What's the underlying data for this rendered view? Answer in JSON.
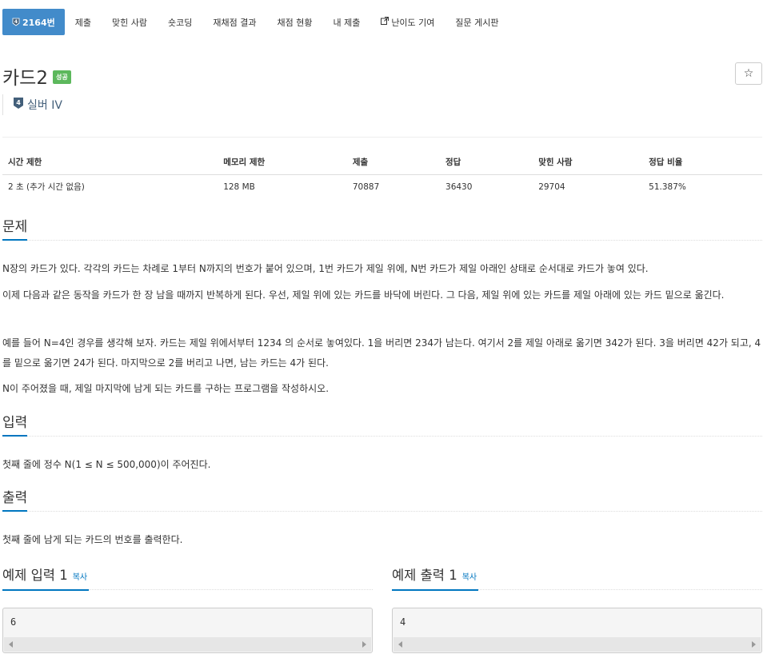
{
  "nav": {
    "tabs": [
      {
        "label": "2164번",
        "icon": "tier-badge-icon"
      },
      {
        "label": "제출"
      },
      {
        "label": "맞힌 사람"
      },
      {
        "label": "숏코딩"
      },
      {
        "label": "재채점 결과"
      },
      {
        "label": "채점 현황"
      },
      {
        "label": "내 제출"
      },
      {
        "label": "난이도 기여",
        "icon": "external-link-icon"
      },
      {
        "label": "질문 게시판"
      }
    ]
  },
  "problem": {
    "title": "카드2",
    "status_badge": "성공",
    "star": "☆",
    "tier_number": "4",
    "tier": "실버 IV"
  },
  "info_table": {
    "headers": [
      "시간 제한",
      "메모리 제한",
      "제출",
      "정답",
      "맞힌 사람",
      "정답 비율"
    ],
    "row": [
      "2 초 (추가 시간 없음)",
      "128 MB",
      "70887",
      "36430",
      "29704",
      "51.387%"
    ]
  },
  "sections": {
    "description_title": "문제",
    "description": [
      "N장의 카드가 있다. 각각의 카드는 차례로 1부터 N까지의 번호가 붙어 있으며, 1번 카드가 제일 위에, N번 카드가 제일 아래인 상태로 순서대로 카드가 놓여 있다.",
      "이제 다음과 같은 동작을 카드가 한 장 남을 때까지 반복하게 된다. 우선, 제일 위에 있는 카드를 바닥에 버린다. 그 다음, 제일 위에 있는 카드를 제일 아래에 있는 카드 밑으로 옮긴다.",
      "예를 들어 N=4인 경우를 생각해 보자. 카드는 제일 위에서부터 1234 의 순서로 놓여있다. 1을 버리면 234가 남는다. 여기서 2를 제일 아래로 옮기면 342가 된다. 3을 버리면 42가 되고, 4를 밑으로 옮기면 24가 된다. 마지막으로 2를 버리고 나면, 남는 카드는 4가 된다.",
      "N이 주어졌을 때, 제일 마지막에 남게 되는 카드를 구하는 프로그램을 작성하시오."
    ],
    "input_title": "입력",
    "input": "첫째 줄에 정수 N(1 ≤ N ≤ 500,000)이 주어진다.",
    "output_title": "출력",
    "output": "첫째 줄에 남게 되는 카드의 번호를 출력한다."
  },
  "samples": {
    "input_title": "예제 입력 1",
    "output_title": "예제 출력 1",
    "copy_label": "복사",
    "input_value": "6",
    "output_value": "4"
  },
  "colors": {
    "active_tab": "#428bca",
    "success_badge": "#5cb85c",
    "tier_silver": "#435f7a",
    "section_underline": "#0076c0"
  }
}
